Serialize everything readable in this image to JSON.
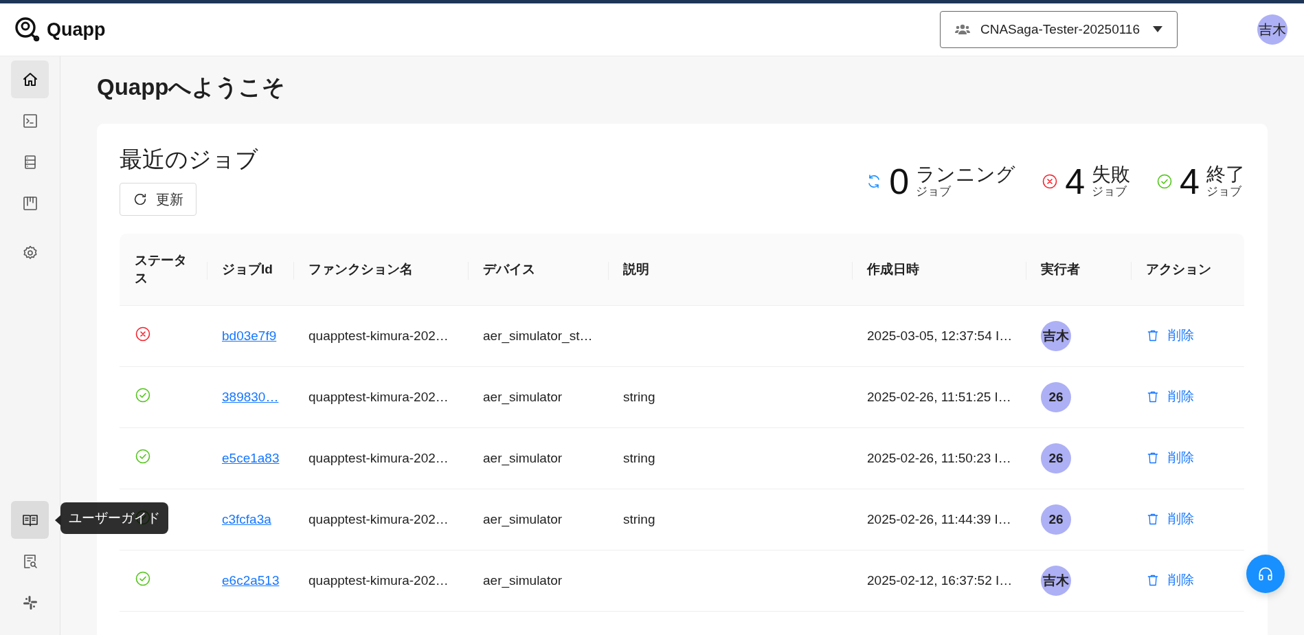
{
  "header": {
    "logo": "Quapp",
    "team_selector": {
      "value": "CNASaga-Tester-20250116"
    },
    "avatar": "吉木"
  },
  "sidebar": {
    "top_items": [
      {
        "selected": true,
        "hovered": false
      },
      {
        "selected": false,
        "hovered": false
      },
      {
        "selected": false,
        "hovered": false
      },
      {
        "selected": false,
        "hovered": false
      },
      {
        "selected": false,
        "hovered": false
      }
    ],
    "bottom_items": [
      {
        "selected": false,
        "hovered": true
      },
      {
        "selected": false,
        "hovered": false
      },
      {
        "selected": false,
        "hovered": false
      }
    ]
  },
  "tooltip": "ユーザーガイド",
  "page_title": "Quappへようこそ",
  "recent_jobs": {
    "title": "最近のジョブ",
    "refresh_button": "更新",
    "stats": [
      {
        "kind": "running",
        "count": "0",
        "label": "ランニング",
        "sublabel": "ジョブ"
      },
      {
        "kind": "failed",
        "count": "4",
        "label": "失敗",
        "sublabel": "ジョブ"
      },
      {
        "kind": "finished",
        "count": "4",
        "label": "終了",
        "sublabel": "ジョブ"
      }
    ],
    "table": {
      "columns": [
        "ステータス",
        "ジョブId",
        "ファンクション名",
        "デバイス",
        "説明",
        "作成日時",
        "実行者",
        "アクション"
      ],
      "rows": [
        {
          "kind": "failed",
          "job_id": "bd03e7f9",
          "function": "quapptest-kimura-202…",
          "device": "aer_simulator_st…",
          "description": "",
          "created": "2025-03-05, 12:37:54 I…",
          "executor": "吉木",
          "action": "削除"
        },
        {
          "kind": "success",
          "job_id": "389830…",
          "function": "quapptest-kimura-202…",
          "device": "aer_simulator",
          "description": "string",
          "created": "2025-02-26, 11:51:25 I…",
          "executor": "26",
          "action": "削除"
        },
        {
          "kind": "success",
          "job_id": "e5ce1a83",
          "function": "quapptest-kimura-202…",
          "device": "aer_simulator",
          "description": "string",
          "created": "2025-02-26, 11:50:23 I…",
          "executor": "26",
          "action": "削除"
        },
        {
          "kind": "success",
          "job_id": "c3fcfa3a",
          "function": "quapptest-kimura-202…",
          "device": "aer_simulator",
          "description": "string",
          "created": "2025-02-26, 11:44:39 I…",
          "executor": "26",
          "action": "削除"
        },
        {
          "kind": "success",
          "job_id": "e6c2a513",
          "function": "quapptest-kimura-202…",
          "device": "aer_simulator",
          "description": "",
          "created": "2025-02-12, 16:37:52 I…",
          "executor": "吉木",
          "action": "削除"
        }
      ]
    }
  }
}
